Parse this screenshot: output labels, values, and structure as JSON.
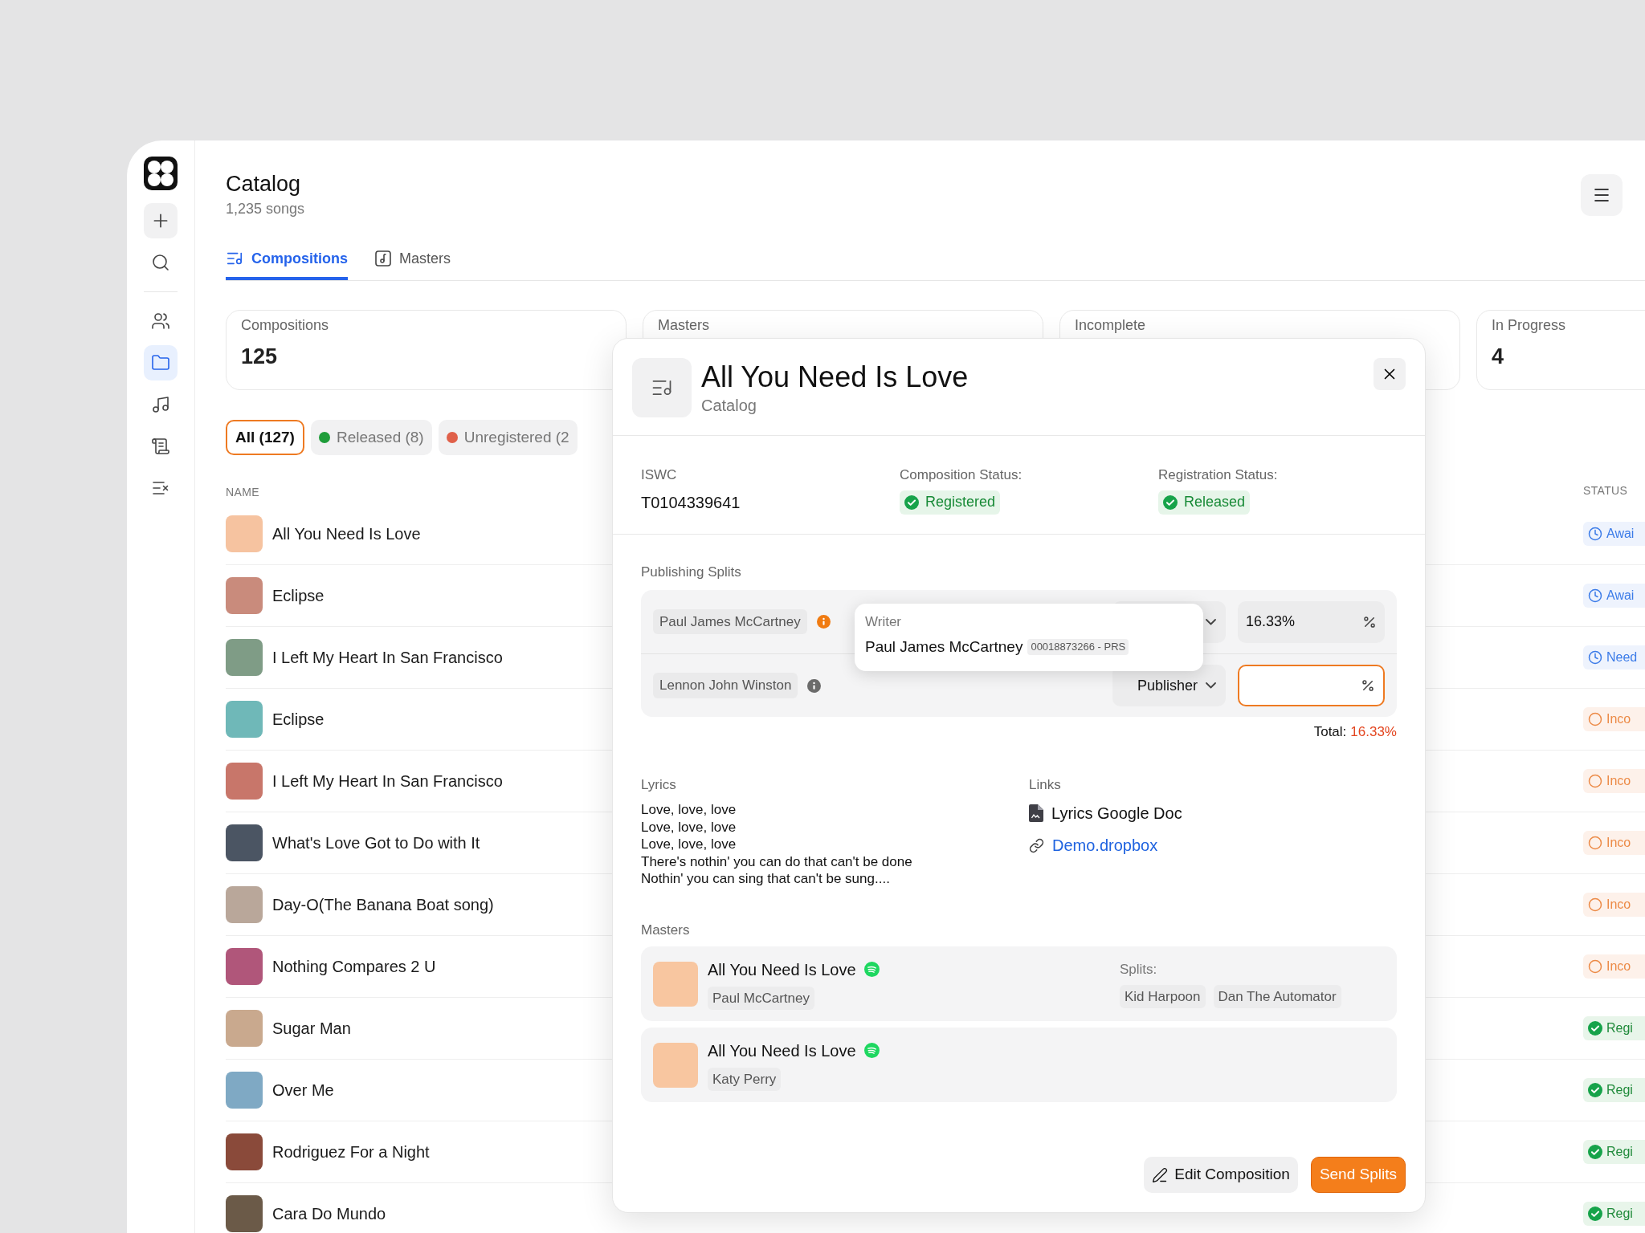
{
  "sidebar": {
    "items": [
      {
        "selected": false
      },
      {
        "selected": false
      },
      {
        "selected": false
      },
      {
        "selected": true
      },
      {
        "selected": false
      },
      {
        "selected": false
      },
      {
        "selected": false
      }
    ]
  },
  "page": {
    "title": "Catalog",
    "subtitle": "1,235 songs"
  },
  "tabs": [
    {
      "label": "Compositions",
      "selected": true
    },
    {
      "label": "Masters",
      "selected": false
    }
  ],
  "stats": [
    {
      "label": "Compositions",
      "value": "125"
    },
    {
      "label": "Masters"
    },
    {
      "label": "Incomplete"
    },
    {
      "label": "In Progress",
      "value": "4"
    }
  ],
  "filters": [
    {
      "label": "All (127)",
      "selected": true
    },
    {
      "label": "Released (8)",
      "selected": false,
      "color": "#1f9d3a"
    },
    {
      "label": "Unregistered (2",
      "selected": false,
      "color": "#e0604a"
    }
  ],
  "table": {
    "columns": [
      "NAME",
      "STATUS"
    ],
    "rows": [
      {
        "name": "All You Need Is Love",
        "status": "Awai",
        "kind": "awaiting"
      },
      {
        "name": "Eclipse",
        "status": "Awai",
        "kind": "awaiting"
      },
      {
        "name": "I Left My Heart In San Francisco",
        "status": "Need",
        "kind": "awaiting"
      },
      {
        "name": "Eclipse",
        "status": "Inco",
        "kind": "incomplete"
      },
      {
        "name": "I Left My Heart In San Francisco",
        "status": "Inco",
        "kind": "incomplete"
      },
      {
        "name": "What's Love Got to Do with It",
        "status": "Inco",
        "kind": "incomplete"
      },
      {
        "name": "Day-O(The Banana Boat song)",
        "status": "Inco",
        "kind": "incomplete"
      },
      {
        "name": "Nothing Compares 2 U",
        "status": "Inco",
        "kind": "incomplete"
      },
      {
        "name": "Sugar Man",
        "status": "Regi",
        "kind": "registered"
      },
      {
        "name": "Over Me",
        "status": "Regi",
        "kind": "registered"
      },
      {
        "name": "Rodriguez For a Night",
        "status": "Regi",
        "kind": "registered"
      },
      {
        "name": "Cara Do Mundo",
        "status": "Regi",
        "kind": "registered"
      }
    ]
  },
  "modal": {
    "title": "All You Need Is Love",
    "subtitle": "Catalog",
    "fields": [
      {
        "label": "ISWC",
        "value": "T0104339641",
        "kind": "text"
      },
      {
        "label": "Composition Status:",
        "value": "Registered",
        "kind": "badge"
      },
      {
        "label": "Registration Status:",
        "value": "Released",
        "kind": "badge"
      }
    ],
    "splits": {
      "title": "Publishing Splits",
      "rows": [
        {
          "name": "Paul James McCartney",
          "warning": true,
          "share": "16.33%",
          "invalid": false
        },
        {
          "name": "Lennon John Winston",
          "warning": false,
          "role": "Publisher",
          "invalid": true
        }
      ],
      "total_label": "Total:",
      "total_value": "16.33%"
    },
    "tooltip": {
      "label": "Writer",
      "name": "Paul James McCartney",
      "code": "00018873266 - PRS"
    },
    "lyrics": {
      "title": "Lyrics",
      "text": "Love, love, love\nLove, love, love\nLove, love, love\nThere's nothin' you can do that can't be done\nNothin' you can sing that can't be sung...."
    },
    "links": {
      "title": "Links",
      "items": [
        {
          "kind": "doc",
          "label": "Lyrics Google Doc"
        },
        {
          "kind": "link",
          "label": "Demo.dropbox"
        }
      ]
    },
    "masters": {
      "title": "Masters",
      "items": [
        {
          "title": "All You Need Is Love",
          "artist": "Paul McCartney",
          "splits_label": "Splits:",
          "splits": [
            "Kid Harpoon",
            "Dan The Automator"
          ]
        },
        {
          "title": "All You Need Is Love",
          "artist": "Katy Perry"
        }
      ]
    },
    "buttons": [
      {
        "label": "Edit Composition",
        "kind": "secondary"
      },
      {
        "label": "Send Splits",
        "kind": "primary"
      }
    ]
  }
}
